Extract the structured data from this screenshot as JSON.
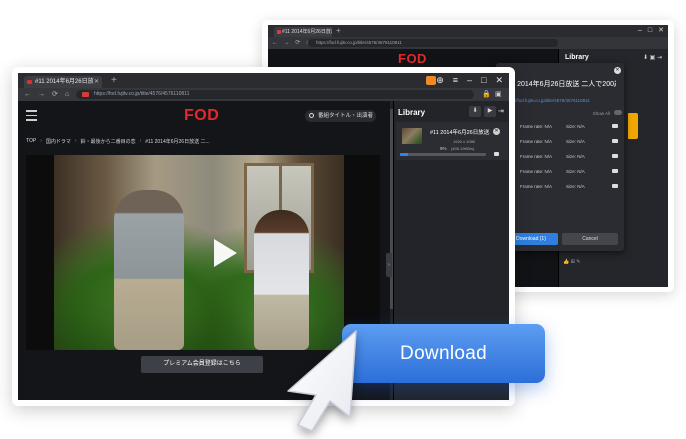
{
  "back_window": {
    "tab_title": "#11 2014年6月26日放送",
    "address": "https://fod.fujitv.co.jp/title/4576/4576110811",
    "brand": "FOD",
    "library_title": "Library",
    "dialog": {
      "title": "#11 2014年6月26日放送 二人で200歳へ！！",
      "url": "https://fod.fujitv.co.jp/title/4576/4576110811",
      "show_all": "Show All",
      "rows": [
        {
          "frame": "Frame rate: N/A",
          "size": "Size: N/A"
        },
        {
          "frame": "Frame rate: N/A",
          "size": "Size: N/A"
        },
        {
          "frame": "Frame rate: N/A",
          "size": "Size: N/A"
        },
        {
          "frame": "Frame rate: N/A",
          "size": "Size: N/A"
        },
        {
          "frame": "Frame rate: N/A",
          "size": "Size: N/A"
        }
      ],
      "download_label": "Download (1)",
      "cancel_label": "Cancel"
    }
  },
  "front_window": {
    "tab_title": "#11 2014年6月26日放",
    "address": "https://fod.fujitv.co.jp/title/4576/4576110811",
    "brand": "FOD",
    "search_placeholder": "番組タイトル・出演者",
    "breadcrumb": [
      "TOP",
      "国内ドラマ",
      "鈴・最後から二番目の恋",
      "#11 2014年6月26日放送 二..."
    ],
    "premium_button": "プレミアム会員登録はこちら",
    "library": {
      "title": "Library",
      "item": {
        "title": "#11 2014年6月26日放送...",
        "resolution": "1920 x 1080",
        "percent": "9%",
        "speed": "(405.19KB/s)",
        "progress": 9
      }
    }
  },
  "download_button": "Download",
  "colors": {
    "accent": "#2c6fd8",
    "brand_red": "#e8262e",
    "progress": "#2f86e8"
  }
}
